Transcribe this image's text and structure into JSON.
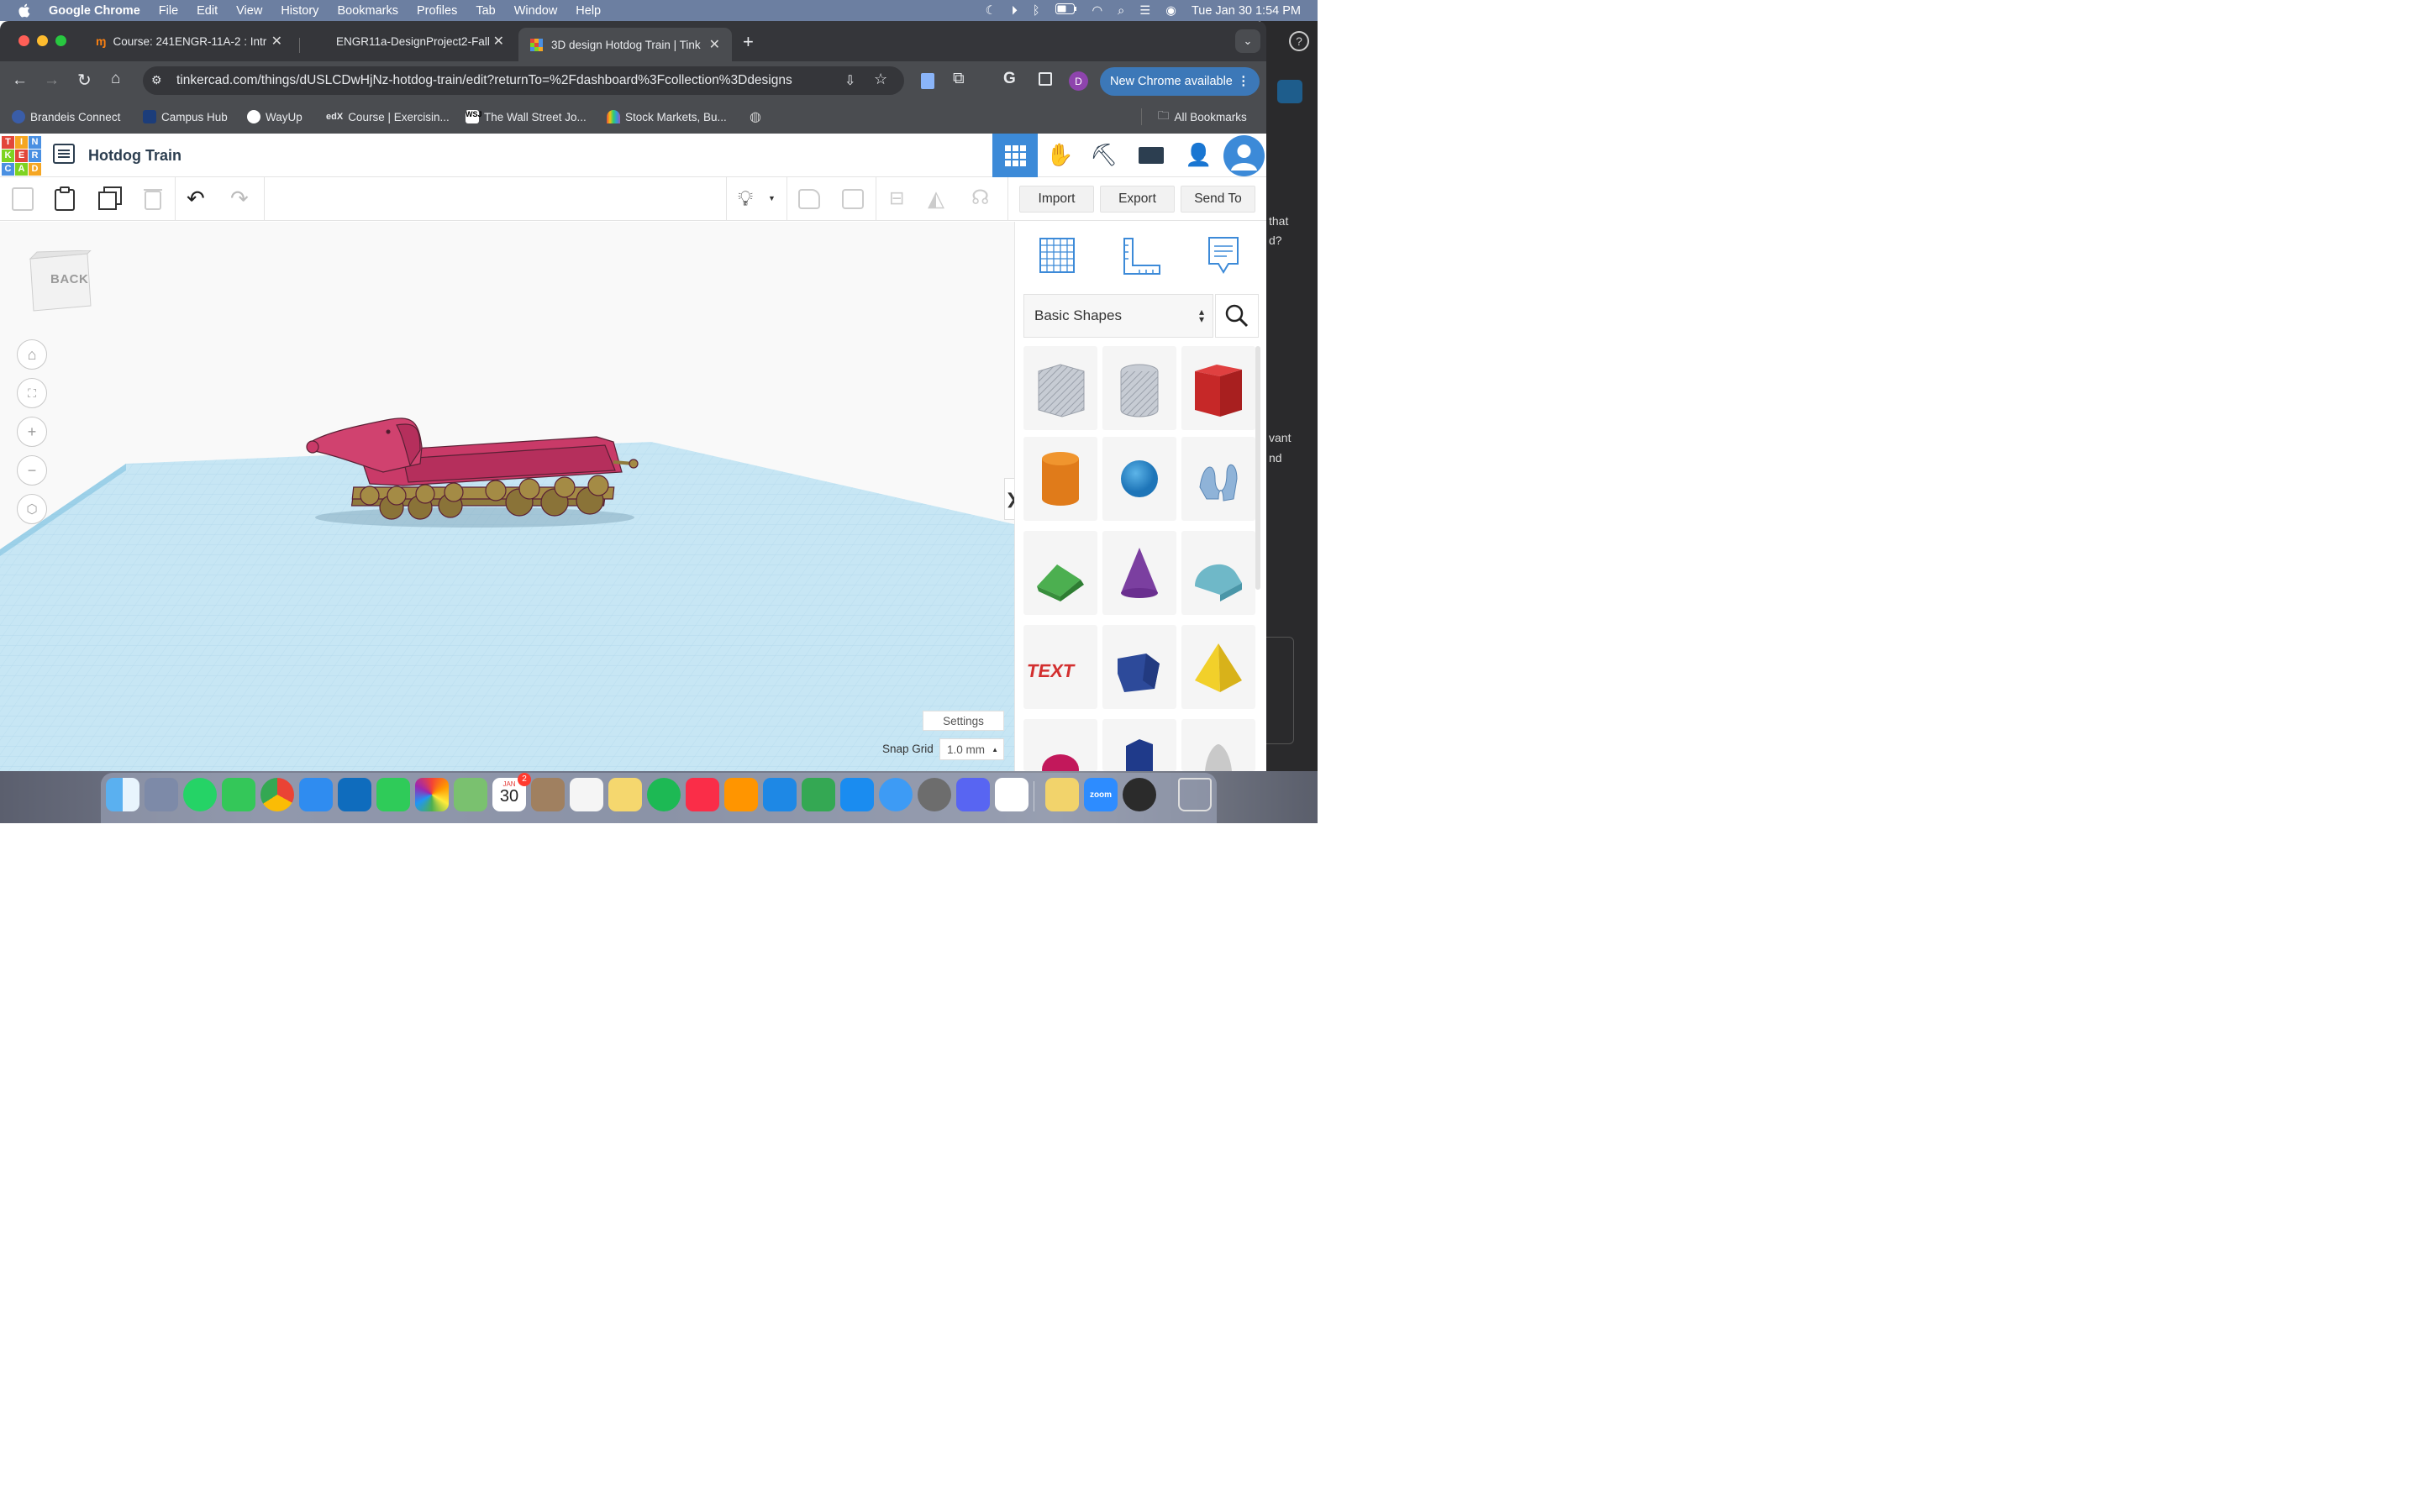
{
  "menubar": {
    "app": "Google Chrome",
    "items": [
      "File",
      "Edit",
      "View",
      "History",
      "Bookmarks",
      "Profiles",
      "Tab",
      "Window",
      "Help"
    ],
    "clock": "Tue Jan 30  1:54 PM"
  },
  "backdrop": {
    "text1": "that",
    "text2": "d?",
    "text3": "vant",
    "text4": "nd"
  },
  "tabs": [
    {
      "title": "Course: 241ENGR-11A-2 : Intr",
      "favicon": "moodle-icon"
    },
    {
      "title": "ENGR11a-DesignProject2-Fall",
      "favicon": "doc-icon"
    },
    {
      "title": "3D design Hotdog Train | Tink",
      "favicon": "tinkercad-icon"
    }
  ],
  "url": "tinkercad.com/things/dUSLCDwHjNz-hotdog-train/edit?returnTo=%2Fdashboard%3Fcollection%3Ddesigns",
  "new_chrome": "New Chrome available",
  "profile_initial": "D",
  "bookmarks": [
    "Brandeis Connect",
    "Campus Hub",
    "WayUp",
    "Course | Exercisin...",
    "The Wall Street Jo...",
    "Stock Markets, Bu..."
  ],
  "all_bookmarks": "All Bookmarks",
  "tinkercad": {
    "logo": [
      "T",
      "I",
      "N",
      "K",
      "E",
      "R",
      "C",
      "A",
      "D"
    ],
    "design_title": "Hotdog Train",
    "import": "Import",
    "export": "Export",
    "send_to": "Send To",
    "view_cube": "BACK",
    "shape_category": "Basic Shapes",
    "settings": "Settings",
    "snap_grid_label": "Snap Grid",
    "snap_grid_value": "1.0 mm"
  },
  "dock": {
    "calendar_month": "JAN",
    "calendar_day": "30",
    "calendar_badge": "2",
    "zoom_label": "zoom"
  },
  "colors": {
    "menubar": "#6c7fa1",
    "accent": "#3c78b8",
    "hotdog": "#c93a68",
    "grid": "#bfe2f2"
  }
}
